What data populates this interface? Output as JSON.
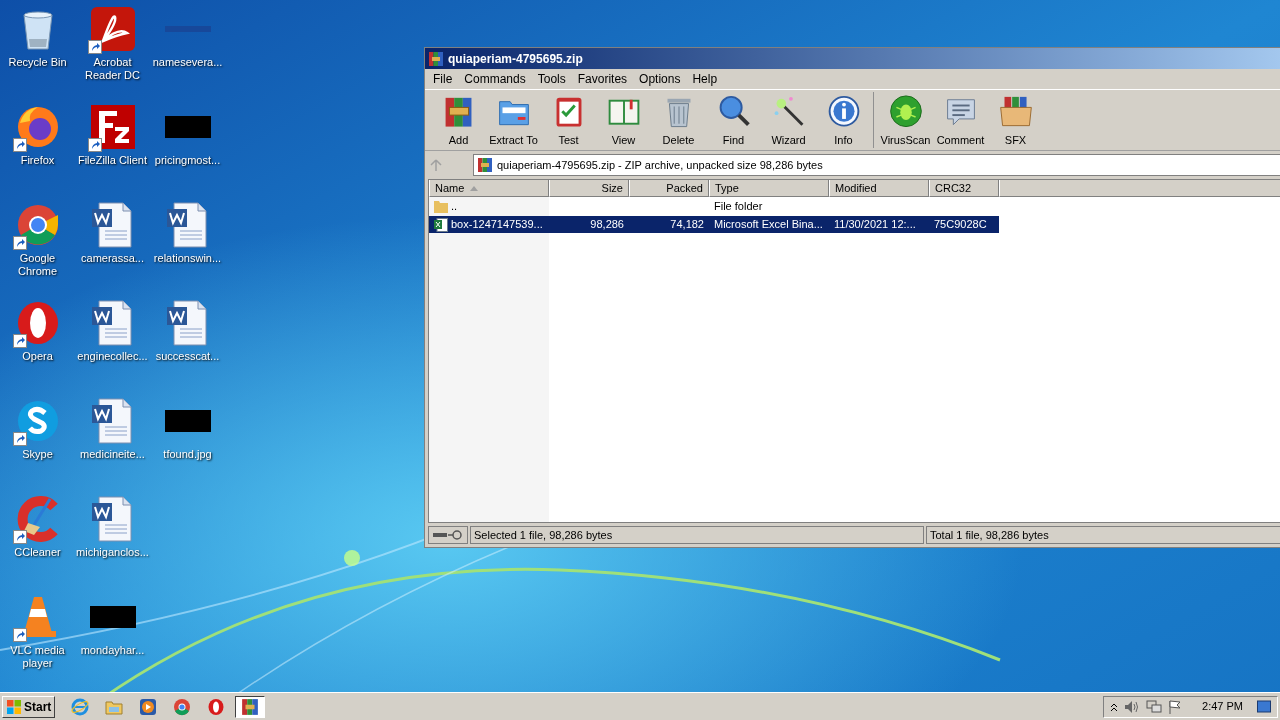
{
  "desktop_icons": [
    {
      "label": "Recycle Bin",
      "kind": "recycle",
      "shortcut": false
    },
    {
      "label": "Firefox",
      "kind": "firefox",
      "shortcut": true
    },
    {
      "label": "Google Chrome",
      "kind": "chrome",
      "shortcut": true
    },
    {
      "label": "Opera",
      "kind": "opera",
      "shortcut": true
    },
    {
      "label": "Skype",
      "kind": "skype",
      "shortcut": true
    },
    {
      "label": "CCleaner",
      "kind": "ccleaner",
      "shortcut": true
    },
    {
      "label": "VLC media player",
      "kind": "vlc",
      "shortcut": true
    },
    {
      "label": "Acrobat Reader DC",
      "kind": "acrobat",
      "shortcut": true
    },
    {
      "label": "FileZilla Client",
      "kind": "filezilla",
      "shortcut": true
    },
    {
      "label": "camerassa...",
      "kind": "word",
      "shortcut": false
    },
    {
      "label": "enginecollec...",
      "kind": "word",
      "shortcut": false
    },
    {
      "label": "medicineite...",
      "kind": "word",
      "shortcut": false
    },
    {
      "label": "michiganclos...",
      "kind": "word",
      "shortcut": false
    },
    {
      "label": "mondayhar...",
      "kind": "dark",
      "shortcut": false
    },
    {
      "label": "namesevera...",
      "kind": "blank",
      "shortcut": false
    },
    {
      "label": "pricingmost...",
      "kind": "dark",
      "shortcut": false
    },
    {
      "label": "relationswin...",
      "kind": "word",
      "shortcut": false
    },
    {
      "label": "successcat...",
      "kind": "word",
      "shortcut": false
    },
    {
      "label": "tfound.jpg",
      "kind": "dark",
      "shortcut": false
    }
  ],
  "window": {
    "title": "quiaperiam-4795695.zip",
    "menu": [
      "File",
      "Commands",
      "Tools",
      "Favorites",
      "Options",
      "Help"
    ],
    "toolbar_groups": [
      [
        {
          "label": "Add",
          "kind": "add"
        },
        {
          "label": "Extract To",
          "kind": "extract"
        },
        {
          "label": "Test",
          "kind": "test"
        },
        {
          "label": "View",
          "kind": "view"
        },
        {
          "label": "Delete",
          "kind": "delete"
        },
        {
          "label": "Find",
          "kind": "find"
        },
        {
          "label": "Wizard",
          "kind": "wizard"
        },
        {
          "label": "Info",
          "kind": "info"
        }
      ],
      [
        {
          "label": "VirusScan",
          "kind": "virus"
        },
        {
          "label": "Comment",
          "kind": "comment"
        },
        {
          "label": "SFX",
          "kind": "sfx"
        }
      ]
    ],
    "path": "quiaperiam-4795695.zip - ZIP archive, unpacked size 98,286 bytes",
    "columns": [
      {
        "label": "Name",
        "sorted": true
      },
      {
        "label": "Size",
        "sorted": false
      },
      {
        "label": "Packed",
        "sorted": false
      },
      {
        "label": "Type",
        "sorted": false
      },
      {
        "label": "Modified",
        "sorted": false
      },
      {
        "label": "CRC32",
        "sorted": false
      }
    ],
    "rows": [
      {
        "kind": "folder",
        "selected": false,
        "name": "..",
        "type": "File folder"
      },
      {
        "kind": "excel",
        "selected": true,
        "name": "box-1247147539...",
        "size": "98,286",
        "packed": "74,182",
        "type": "Microsoft Excel Bina...",
        "modified": "11/30/2021 12:...",
        "crc32": "75C9028C"
      }
    ],
    "status_selected": "Selected 1 file, 98,286 bytes",
    "status_total": "Total 1 file, 98,286 bytes"
  },
  "taskbar": {
    "start": "Start",
    "items": [
      {
        "kind": "ie",
        "active": false
      },
      {
        "kind": "explorer",
        "active": false
      },
      {
        "kind": "media",
        "active": false
      },
      {
        "kind": "chrome",
        "active": false
      },
      {
        "kind": "opera",
        "active": false
      },
      {
        "kind": "winrar",
        "active": true
      }
    ],
    "clock": "2:47 PM"
  }
}
